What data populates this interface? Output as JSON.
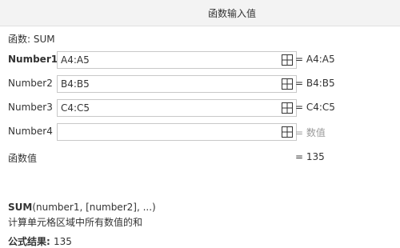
{
  "dialog": {
    "title": "函数输入值"
  },
  "function": {
    "label": "函数: SUM"
  },
  "args": [
    {
      "name": "Number1",
      "value": "A4:A5",
      "result": "= A4:A5",
      "bold": true
    },
    {
      "name": "Number2",
      "value": "B4:B5",
      "result": "= B4:B5",
      "bold": false
    },
    {
      "name": "Number3",
      "value": "C4:C5",
      "result": "= C4:C5",
      "bold": false
    },
    {
      "name": "Number4",
      "value": "",
      "result": "= 数值",
      "bold": false
    }
  ],
  "function_value": {
    "label": "函数值",
    "result": "= 135"
  },
  "syntax": {
    "name": "SUM",
    "params": "(number1, [number2], ...)"
  },
  "description": "计算单元格区域中所有数值的和",
  "formula_result": {
    "label": "公式结果: ",
    "value": "135"
  },
  "icons": {
    "ref_picker": "grid-ref-icon"
  },
  "colors": {
    "title_bg": "#f3f3f3",
    "border": "#c8c8c8",
    "muted": "#999999"
  }
}
